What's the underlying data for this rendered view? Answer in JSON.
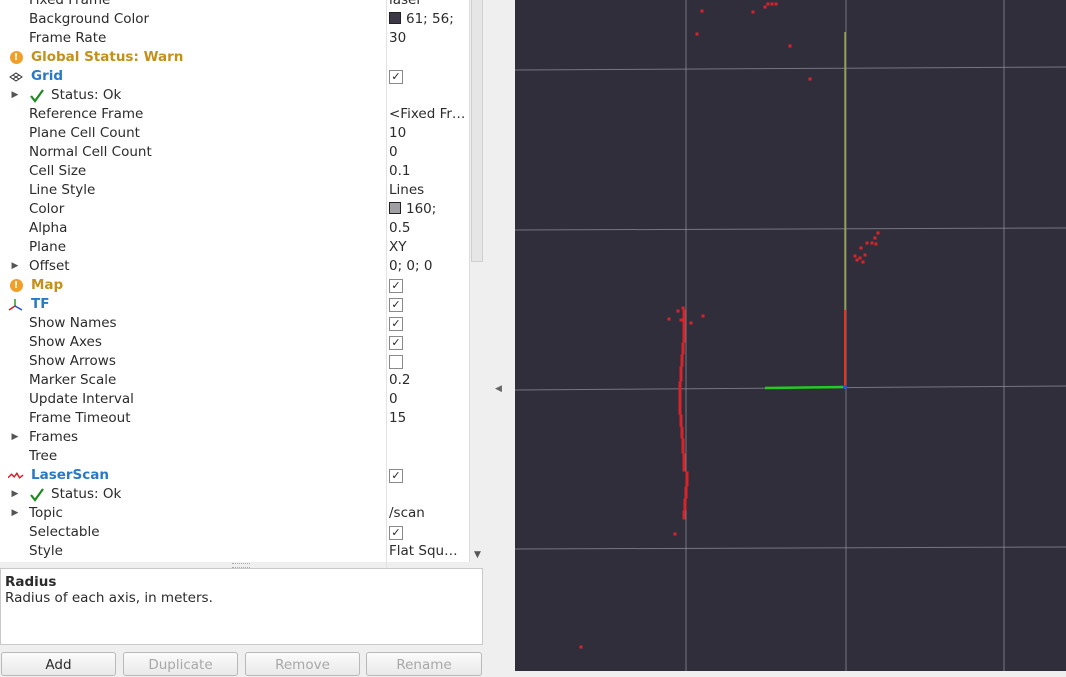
{
  "displays": {
    "rows": [
      {
        "name": "Fixed Frame",
        "value": "laser",
        "indent": 29
      },
      {
        "name": "Background Color",
        "value": "61; 56;",
        "swatch": "#3d3848",
        "indent": 29
      },
      {
        "name": "Frame Rate",
        "value": "30",
        "indent": 29
      },
      {
        "name": "Global Status: Warn",
        "icon": "warning-icon",
        "style": "warn",
        "indent": 31
      },
      {
        "name": "Grid",
        "icon": "grid-icon",
        "style": "blue",
        "checkbox": true,
        "checked": true,
        "indent": 31
      },
      {
        "name": "Status: Ok",
        "icon": "check-icon",
        "arrow": true,
        "indent": 51
      },
      {
        "name": "Reference Frame",
        "value": "<Fixed Fr…",
        "indent": 29
      },
      {
        "name": "Plane Cell Count",
        "value": "10",
        "indent": 29
      },
      {
        "name": "Normal Cell Count",
        "value": "0",
        "indent": 29
      },
      {
        "name": "Cell Size",
        "value": "0.1",
        "indent": 29
      },
      {
        "name": "Line Style",
        "value": "Lines",
        "indent": 29
      },
      {
        "name": "Color",
        "value": "160;",
        "swatch": "#a0a0a4",
        "indent": 29
      },
      {
        "name": "Alpha",
        "value": "0.5",
        "indent": 29
      },
      {
        "name": "Plane",
        "value": "XY",
        "indent": 29
      },
      {
        "name": "Offset",
        "value": "0; 0; 0",
        "arrow": true,
        "indent": 29
      },
      {
        "name": "Map",
        "icon": "warning-icon",
        "style": "warn",
        "checkbox": true,
        "checked": true,
        "indent": 31
      },
      {
        "name": "TF",
        "icon": "axes-icon",
        "style": "blue",
        "checkbox": true,
        "checked": true,
        "indent": 31
      },
      {
        "name": "Show Names",
        "checkbox": true,
        "checked": true,
        "indent": 29
      },
      {
        "name": "Show Axes",
        "checkbox": true,
        "checked": true,
        "indent": 29
      },
      {
        "name": "Show Arrows",
        "checkbox": true,
        "checked": false,
        "indent": 29
      },
      {
        "name": "Marker Scale",
        "value": "0.2",
        "indent": 29
      },
      {
        "name": "Update Interval",
        "value": "0",
        "indent": 29
      },
      {
        "name": "Frame Timeout",
        "value": "15",
        "indent": 29
      },
      {
        "name": "Frames",
        "arrow": true,
        "indent": 29
      },
      {
        "name": "Tree",
        "indent": 29
      },
      {
        "name": "LaserScan",
        "icon": "laserscan-icon",
        "style": "blue",
        "checkbox": true,
        "checked": true,
        "indent": 31
      },
      {
        "name": "Status: Ok",
        "icon": "check-icon",
        "arrow": true,
        "indent": 51
      },
      {
        "name": "Topic",
        "value": "/scan",
        "arrow": true,
        "indent": 29
      },
      {
        "name": "Selectable",
        "checkbox": true,
        "checked": true,
        "indent": 29
      },
      {
        "name": "Style",
        "value": "Flat Squ…",
        "indent": 29
      }
    ]
  },
  "description": {
    "title": "Radius",
    "text": "Radius of each axis, in meters."
  },
  "buttons": {
    "add": "Add",
    "duplicate": "Duplicate",
    "remove": "Remove",
    "rename": "Rename"
  },
  "colors": {
    "background": "#312e3b",
    "grid": "#8f8c98",
    "scan_points": "#d9232a",
    "axis_x": "#e8331e",
    "axis_y": "#22cc22",
    "axis_z": "#a8b84a"
  }
}
